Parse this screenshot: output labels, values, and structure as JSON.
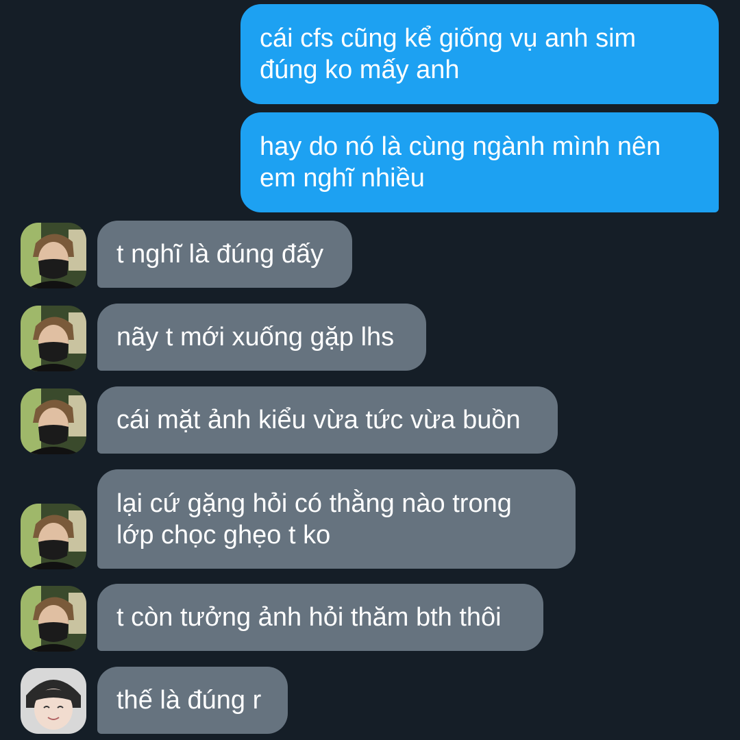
{
  "messages": [
    {
      "side": "out",
      "lines": [
        "cái cfs cũng kể giống vụ anh sim",
        "đúng ko mấy anh"
      ]
    },
    {
      "side": "out",
      "lines": [
        "hay do nó là cùng ngành mình nên",
        "em nghĩ nhiều"
      ]
    },
    {
      "side": "in",
      "avatar": "masked-boy",
      "lines": [
        "t nghĩ là đúng đấy"
      ]
    },
    {
      "side": "in",
      "avatar": "masked-boy",
      "lines": [
        "nãy t mới xuống gặp lhs"
      ]
    },
    {
      "side": "in",
      "avatar": "masked-boy",
      "lines": [
        "cái mặt ảnh kiểu vừa tức vừa buồn"
      ]
    },
    {
      "side": "in",
      "avatar": "masked-boy",
      "lines": [
        "lại cứ gặng hỏi có thằng nào trong",
        "lớp chọc ghẹo t ko"
      ]
    },
    {
      "side": "in",
      "avatar": "masked-boy",
      "lines": [
        "t còn tưởng ảnh hỏi thăm bth thôi"
      ]
    },
    {
      "side": "in",
      "avatar": "smiling-face",
      "lines": [
        "thế là đúng r"
      ]
    }
  ],
  "colors": {
    "background": "#151e27",
    "outgoing_bubble": "#1da1f2",
    "incoming_bubble": "#66737f",
    "text": "#ffffff"
  }
}
